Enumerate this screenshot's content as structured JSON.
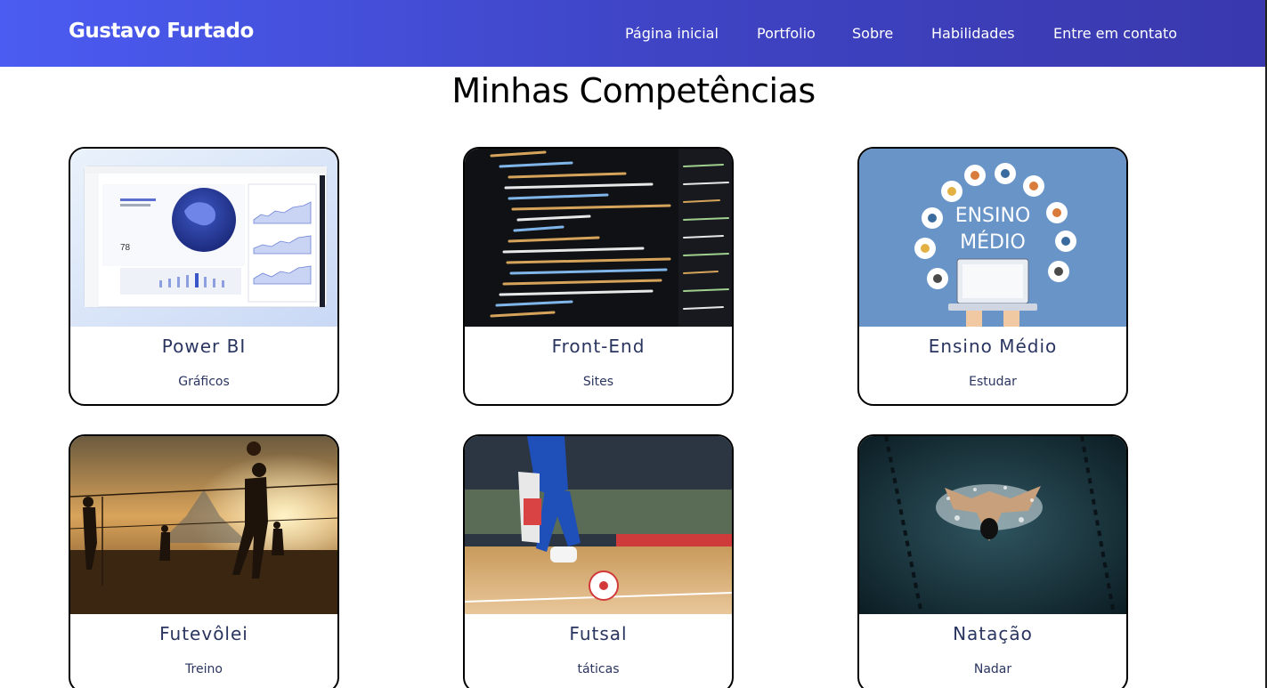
{
  "header": {
    "brand": "Gustavo Furtado",
    "nav": [
      {
        "label": "Página inicial"
      },
      {
        "label": "Portfolio"
      },
      {
        "label": "Sobre"
      },
      {
        "label": "Habilidades"
      },
      {
        "label": "Entre em contato"
      }
    ]
  },
  "main": {
    "title": "Minhas Competências",
    "cards": [
      {
        "title": "Power BI",
        "subtitle": "Gráficos",
        "image": "power-bi-dashboard-image"
      },
      {
        "title": "Front-End",
        "subtitle": "Sites",
        "image": "code-editor-image"
      },
      {
        "title": "Ensino Médio",
        "subtitle": "Estudar",
        "image": "ensino-medio-illustration",
        "image_text": [
          "ENSINO",
          "MÉDIO"
        ]
      },
      {
        "title": "Futevôlei",
        "subtitle": "Treino",
        "image": "beach-footvolley-image"
      },
      {
        "title": "Futsal",
        "subtitle": "táticas",
        "image": "futsal-players-image"
      },
      {
        "title": "Natação",
        "subtitle": "Nadar",
        "image": "swimmer-pool-image"
      }
    ]
  },
  "colors": {
    "nav_gradient_start": "#4b5cf2",
    "nav_gradient_end": "#3a38ad",
    "card_text": "#2a3560"
  }
}
